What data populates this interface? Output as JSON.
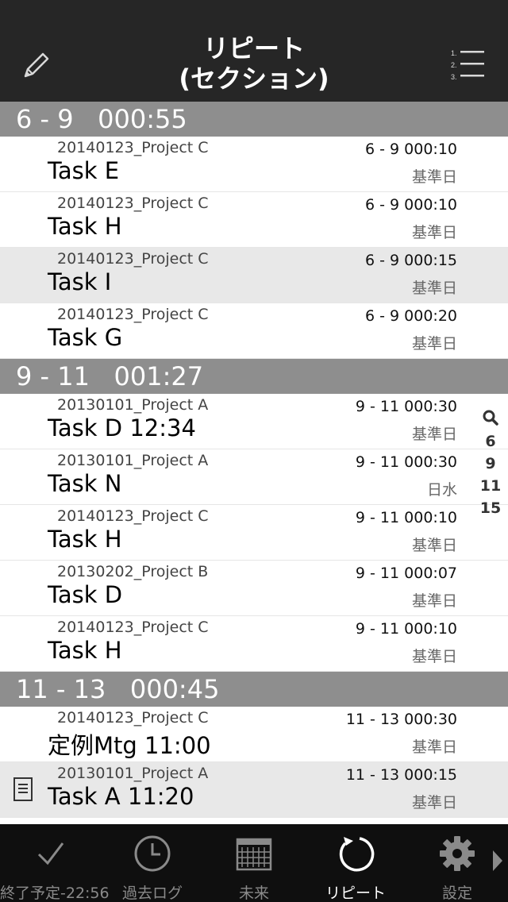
{
  "nav": {
    "title_line1": "リピート",
    "title_line2": "(セクション)",
    "edit_icon": "pencil-icon",
    "list_icon": "numbered-list-icon"
  },
  "sections": [
    {
      "header": "6 - 9   000:55",
      "rows": [
        {
          "project": "20140123_Project C",
          "task": "Task E",
          "range": "6 - 9 000:10",
          "day": "基準日",
          "highlighted": false,
          "note": false
        },
        {
          "project": "20140123_Project C",
          "task": "Task H",
          "range": "6 - 9 000:10",
          "day": "基準日",
          "highlighted": false,
          "note": false
        },
        {
          "project": "20140123_Project C",
          "task": "Task I",
          "range": "6 - 9 000:15",
          "day": "基準日",
          "highlighted": true,
          "note": false
        },
        {
          "project": "20140123_Project C",
          "task": "Task G",
          "range": "6 - 9 000:20",
          "day": "基準日",
          "highlighted": false,
          "note": false
        }
      ]
    },
    {
      "header": "9 - 11   001:27",
      "rows": [
        {
          "project": "20130101_Project A",
          "task": "Task D 12:34",
          "range": "9 - 11 000:30",
          "day": "基準日",
          "highlighted": false,
          "note": false
        },
        {
          "project": "20130101_Project A",
          "task": "Task N",
          "range": "9 - 11 000:30",
          "day": "日水",
          "highlighted": false,
          "note": false
        },
        {
          "project": "20140123_Project C",
          "task": "Task H",
          "range": "9 - 11 000:10",
          "day": "基準日",
          "highlighted": false,
          "note": false
        },
        {
          "project": "20130202_Project B",
          "task": "Task D",
          "range": "9 - 11 000:07",
          "day": "基準日",
          "highlighted": false,
          "note": false
        },
        {
          "project": "20140123_Project C",
          "task": "Task H",
          "range": "9 - 11 000:10",
          "day": "基準日",
          "highlighted": false,
          "note": false
        }
      ]
    },
    {
      "header": "11 - 13   000:45",
      "rows": [
        {
          "project": "20140123_Project C",
          "task": "定例Mtg 11:00",
          "range": "11 - 13 000:30",
          "day": "基準日",
          "highlighted": false,
          "note": false
        },
        {
          "project": "20130101_Project A",
          "task": "Task A 11:20",
          "range": "11 - 13 000:15",
          "day": "基準日",
          "highlighted": true,
          "note": true
        }
      ]
    }
  ],
  "index": [
    "6",
    "9",
    "11",
    "15"
  ],
  "tabs": [
    {
      "label": "終了予定-22:56",
      "icon": "checkmark-icon",
      "active": false
    },
    {
      "label": "過去ログ",
      "icon": "clock-icon",
      "active": false
    },
    {
      "label": "未来",
      "icon": "calendar-icon",
      "active": false
    },
    {
      "label": "リピート",
      "icon": "repeat-icon",
      "active": true
    },
    {
      "label": "設定",
      "icon": "gear-icon",
      "active": false
    }
  ]
}
